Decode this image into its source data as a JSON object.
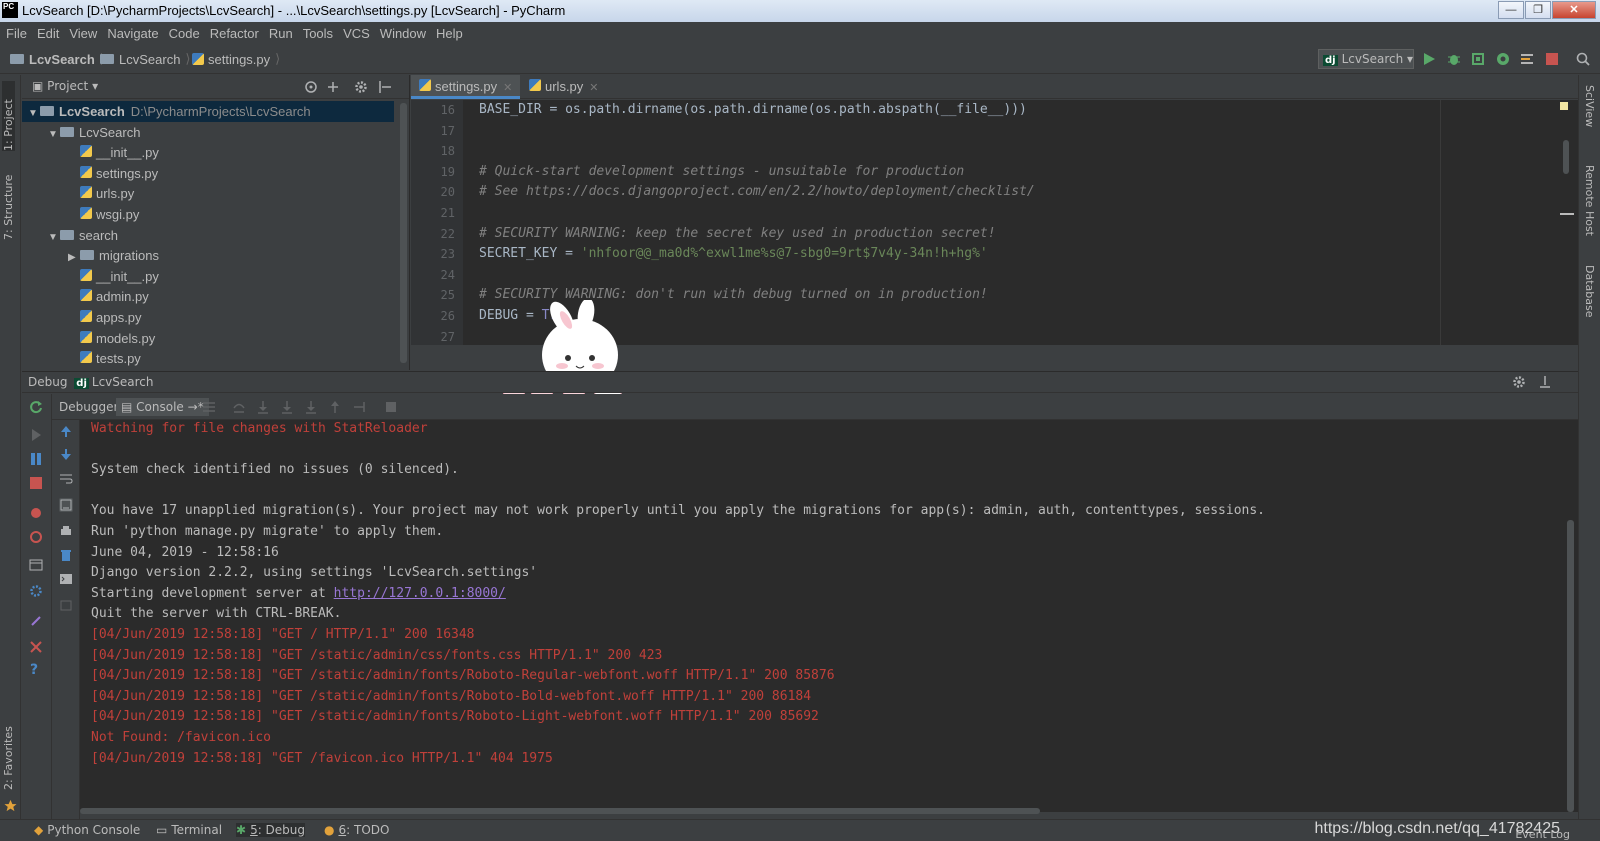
{
  "titlebar": {
    "app_icon": "PC",
    "title": "LcvSearch [D:\\PycharmProjects\\LcvSearch] - ...\\LcvSearch\\settings.py [LcvSearch] - PyCharm",
    "buttons": [
      "—",
      "❐",
      "✕"
    ]
  },
  "menu": [
    "File",
    "Edit",
    "View",
    "Navigate",
    "Code",
    "Refactor",
    "Run",
    "Tools",
    "VCS",
    "Window",
    "Help"
  ],
  "breadcrumbs": [
    "LcvSearch",
    "LcvSearch",
    "settings.py"
  ],
  "run_config": {
    "badge": "dj",
    "label": "LcvSearch"
  },
  "left_strip": {
    "project": "1: Project",
    "structure": "7: Structure",
    "favorites": "2: Favorites"
  },
  "right_strip": {
    "sciview": "SciView",
    "remote": "Remote Host",
    "database": "Database"
  },
  "project_panel": {
    "title": "Project",
    "tree": [
      {
        "label": "LcvSearch",
        "path": "D:\\PycharmProjects\\LcvSearch",
        "type": "folder",
        "depth": 0,
        "arrow": "▼",
        "selected": true
      },
      {
        "label": "LcvSearch",
        "type": "folder",
        "depth": 1,
        "arrow": "▼"
      },
      {
        "label": "__init__.py",
        "type": "py",
        "depth": 2
      },
      {
        "label": "settings.py",
        "type": "py",
        "depth": 2
      },
      {
        "label": "urls.py",
        "type": "py",
        "depth": 2
      },
      {
        "label": "wsgi.py",
        "type": "py",
        "depth": 2
      },
      {
        "label": "search",
        "type": "folder",
        "depth": 1,
        "arrow": "▼"
      },
      {
        "label": "migrations",
        "type": "folder",
        "depth": 2,
        "arrow": "▶"
      },
      {
        "label": "__init__.py",
        "type": "py",
        "depth": 2
      },
      {
        "label": "admin.py",
        "type": "py",
        "depth": 2
      },
      {
        "label": "apps.py",
        "type": "py",
        "depth": 2
      },
      {
        "label": "models.py",
        "type": "py",
        "depth": 2
      },
      {
        "label": "tests.py",
        "type": "py",
        "depth": 2
      }
    ]
  },
  "editor": {
    "tabs": [
      {
        "label": "settings.py",
        "active": true
      },
      {
        "label": "urls.py",
        "active": false
      }
    ],
    "lines": [
      {
        "num": "16",
        "parts": [
          {
            "t": "BASE_DIR = os.path.dirname(os.path.dirname(os.path.abspath(__file__)))",
            "c": ""
          }
        ]
      },
      {
        "num": "17",
        "parts": []
      },
      {
        "num": "18",
        "parts": []
      },
      {
        "num": "19",
        "parts": [
          {
            "t": "# Quick-start development settings - unsuitable for production",
            "c": "comment"
          }
        ]
      },
      {
        "num": "20",
        "parts": [
          {
            "t": "# See https://docs.djangoproject.com/en/2.2/howto/deployment/checklist/",
            "c": "comment"
          }
        ]
      },
      {
        "num": "21",
        "parts": []
      },
      {
        "num": "22",
        "parts": [
          {
            "t": "# SECURITY WARNING: keep the secret key used in production secret!",
            "c": "comment"
          }
        ]
      },
      {
        "num": "23",
        "parts": [
          {
            "t": "SECRET_KEY = ",
            "c": ""
          },
          {
            "t": "'nhfoor@@_ma0d%^exwl1me%s@7-sbg0=9rt$7v4y-34n!h+hg%'",
            "c": "str"
          }
        ]
      },
      {
        "num": "24",
        "parts": []
      },
      {
        "num": "25",
        "parts": [
          {
            "t": "# SECURITY WARNING: don't run with debug turned on in production!",
            "c": "comment"
          }
        ]
      },
      {
        "num": "26",
        "parts": [
          {
            "t": "DEBUG = ",
            "c": ""
          },
          {
            "t": "Tru",
            "c": "const"
          }
        ]
      },
      {
        "num": "27",
        "parts": []
      }
    ]
  },
  "debug": {
    "header_prefix": "Debug",
    "badge": "dj",
    "config": "LcvSearch",
    "tabs": [
      {
        "label": "Debugger",
        "active": false
      },
      {
        "label": "Console",
        "active": true
      }
    ],
    "console_lines": [
      {
        "text": "Watching for file changes with StatReloader",
        "err": true
      },
      {
        "text": "",
        "err": false
      },
      {
        "text": "System check identified no issues (0 silenced).",
        "err": false
      },
      {
        "text": "",
        "err": false
      },
      {
        "text": "You have 17 unapplied migration(s). Your project may not work properly until you apply the migrations for app(s): admin, auth, contenttypes, sessions.",
        "err": false
      },
      {
        "text": "Run 'python manage.py migrate' to apply them.",
        "err": false
      },
      {
        "text": "June 04, 2019 - 12:58:16",
        "err": false
      },
      {
        "text": "Django version 2.2.2, using settings 'LcvSearch.settings'",
        "err": false
      },
      {
        "text": "Starting development server at ",
        "link": "http://127.0.0.1:8000/",
        "err": false
      },
      {
        "text": "Quit the server with CTRL-BREAK.",
        "err": false
      },
      {
        "text": "[04/Jun/2019 12:58:18] \"GET / HTTP/1.1\" 200 16348",
        "err": true
      },
      {
        "text": "[04/Jun/2019 12:58:18] \"GET /static/admin/css/fonts.css HTTP/1.1\" 200 423",
        "err": true
      },
      {
        "text": "[04/Jun/2019 12:58:18] \"GET /static/admin/fonts/Roboto-Regular-webfont.woff HTTP/1.1\" 200 85876",
        "err": true
      },
      {
        "text": "[04/Jun/2019 12:58:18] \"GET /static/admin/fonts/Roboto-Bold-webfont.woff HTTP/1.1\" 200 86184",
        "err": true
      },
      {
        "text": "[04/Jun/2019 12:58:18] \"GET /static/admin/fonts/Roboto-Light-webfont.woff HTTP/1.1\" 200 85692",
        "err": true
      },
      {
        "text": "Not Found: /favicon.ico",
        "err": true
      },
      {
        "text": "[04/Jun/2019 12:58:18] \"GET /favicon.ico HTTP/1.1\" 404 1975",
        "err": true
      }
    ]
  },
  "bottom_bar": {
    "tabs": [
      {
        "label": "Python Console",
        "prefix": "",
        "icon": "python-icon"
      },
      {
        "label": "Terminal",
        "prefix": "",
        "icon": "terminal-icon"
      },
      {
        "label": ": Debug",
        "prefix": "5",
        "icon": "bug-icon",
        "active": true
      },
      {
        "label": ": TODO",
        "prefix": "6",
        "icon": "todo-icon"
      }
    ],
    "watermark": "https://blog.csdn.net/qq_41782425",
    "event_log": "Event Log"
  },
  "colors": {
    "accent": "#4a88c7",
    "error_text": "#c0403a",
    "comment": "#808080",
    "string": "#6a8759",
    "link": "#9876d4"
  }
}
